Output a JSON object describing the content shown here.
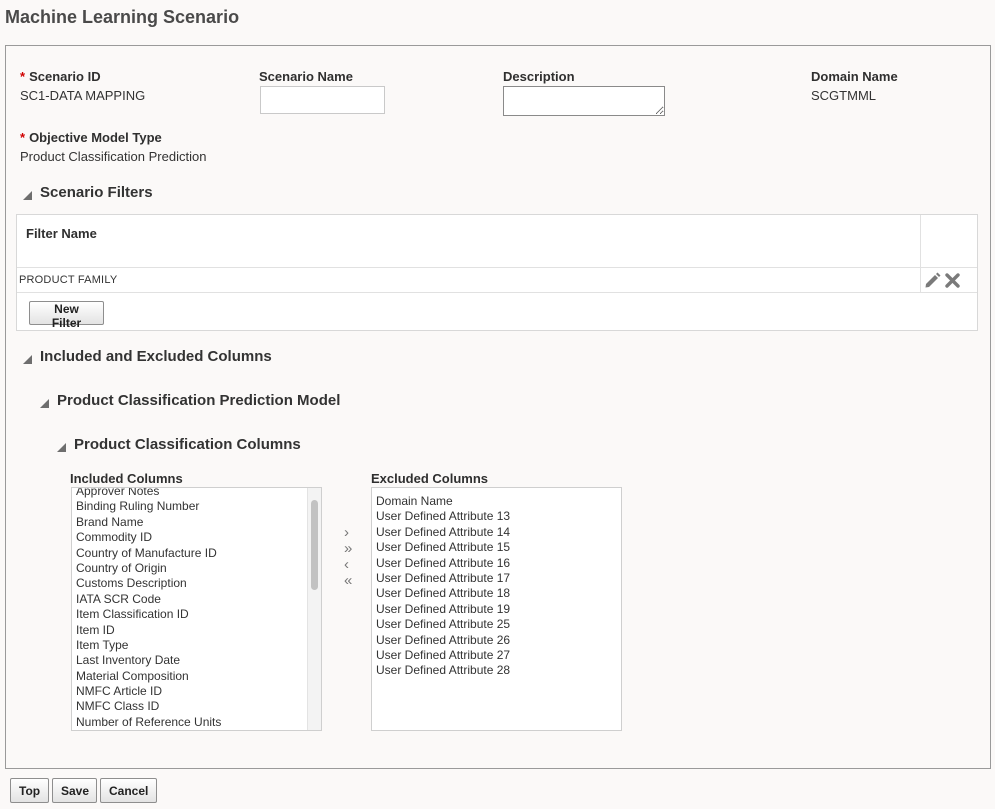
{
  "page": {
    "title": "Machine Learning Scenario"
  },
  "fields": {
    "scenario_id": {
      "label": "Scenario ID",
      "value": "SC1-DATA MAPPING"
    },
    "scenario_name": {
      "label": "Scenario Name",
      "value": ""
    },
    "description": {
      "label": "Description",
      "value": ""
    },
    "domain_name": {
      "label": "Domain Name",
      "value": "SCGTMML"
    },
    "objective_model_type": {
      "label": "Objective Model Type",
      "value": "Product Classification Prediction"
    },
    "required_marker": "*"
  },
  "scenario_filters": {
    "header": "Scenario Filters",
    "column_header": "Filter Name",
    "rows": [
      "PRODUCT FAMILY"
    ],
    "new_filter_label": "New Filter"
  },
  "columns_section": {
    "header": "Included and Excluded Columns",
    "model_header": "Product Classification Prediction Model",
    "columns_header": "Product Classification Columns",
    "included_title": "Included Columns",
    "excluded_title": "Excluded Columns",
    "included": [
      "Approver Notes",
      "Binding Ruling Number",
      "Brand Name",
      "Commodity ID",
      "Country of Manufacture ID",
      "Country of Origin",
      "Customs Description",
      "IATA SCR Code",
      "Item Classification ID",
      "Item ID",
      "Item Type",
      "Last Inventory Date",
      "Material Composition",
      "NMFC Article ID",
      "NMFC Class ID",
      "Number of Reference Units"
    ],
    "excluded": [
      "Domain Name",
      "User Defined Attribute 13",
      "User Defined Attribute 14",
      "User Defined Attribute 15",
      "User Defined Attribute 16",
      "User Defined Attribute 17",
      "User Defined Attribute 18",
      "User Defined Attribute 19",
      "User Defined Attribute 25",
      "User Defined Attribute 26",
      "User Defined Attribute 27",
      "User Defined Attribute 28"
    ],
    "shuttle": {
      "move": "›",
      "move_all": "»",
      "remove": "‹",
      "remove_all": "«"
    }
  },
  "footer": {
    "top_label": "Top",
    "save_label": "Save",
    "cancel_label": "Cancel"
  },
  "colors": {
    "required": "#d00000",
    "icon": "#7a7a7a"
  }
}
